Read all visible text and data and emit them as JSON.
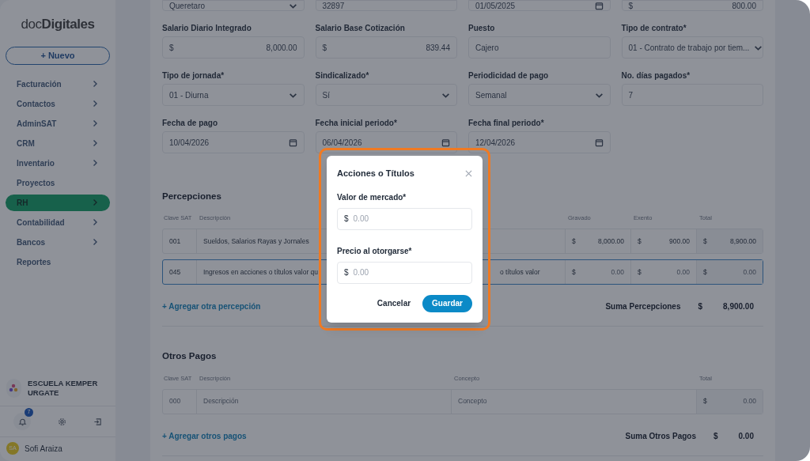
{
  "sidebar": {
    "logo": "doc**Digitales**",
    "new_button": "+ Nuevo",
    "items": [
      {
        "label": "Facturación",
        "has_submenu": true,
        "selected": false
      },
      {
        "label": "Contactos",
        "has_submenu": true,
        "selected": false
      },
      {
        "label": "AdminSAT",
        "has_submenu": true,
        "selected": false
      },
      {
        "label": "CRM",
        "has_submenu": true,
        "selected": false
      },
      {
        "label": "Inventario",
        "has_submenu": true,
        "selected": false
      },
      {
        "label": "Proyectos",
        "has_submenu": false,
        "selected": false
      },
      {
        "label": "RH",
        "has_submenu": true,
        "selected": true
      },
      {
        "label": "Contabilidad",
        "has_submenu": true,
        "selected": false
      },
      {
        "label": "Bancos",
        "has_submenu": true,
        "selected": false
      },
      {
        "label": "Reportes",
        "has_submenu": false,
        "selected": false
      }
    ],
    "company": "ESCUELA KEMPER URGATE",
    "notifications": "7",
    "user_initials": "SA",
    "user_name": "Sofi Araiza"
  },
  "form_rows": [
    [
      {
        "kind": "select",
        "value": "Queretaro"
      },
      {
        "kind": "text",
        "value": "32897"
      },
      {
        "kind": "date",
        "value": "01/05/2025"
      },
      {
        "kind": "money",
        "value": "800.00"
      }
    ],
    [
      {
        "kind": "money",
        "label": "Salario Diario Integrado",
        "value": "8,000.00"
      },
      {
        "kind": "money",
        "label": "Salario Base Cotización",
        "value": "839.44"
      },
      {
        "kind": "text",
        "label": "Puesto",
        "value": "Cajero"
      },
      {
        "kind": "select",
        "label": "Tipo de contrato*",
        "value": "01 - Contrato de trabajo por tiem..."
      }
    ],
    [
      {
        "kind": "select",
        "label": "Tipo de jornada*",
        "value": "01 - Diurna"
      },
      {
        "kind": "select",
        "label": "Sindicalizado*",
        "value": "Sí"
      },
      {
        "kind": "select",
        "label": "Periodicidad de pago",
        "value": "Semanal"
      },
      {
        "kind": "text",
        "label": "No. días pagados*",
        "value": "7"
      }
    ],
    [
      {
        "kind": "date",
        "label": "Fecha de pago",
        "value": "10/04/2026"
      },
      {
        "kind": "date",
        "label": "Fecha inicial periodo*",
        "value": "06/04/2026"
      },
      {
        "kind": "date",
        "label": "Fecha final periodo*",
        "value": "12/04/2026"
      }
    ]
  ],
  "percepciones": {
    "title": "Percepciones",
    "columns": [
      "Clave SAT",
      "Descripción",
      "Gravado",
      "Exento",
      "Total"
    ],
    "rows": [
      {
        "clave": "001",
        "descripcion": "Sueldos, Salarios Rayas y Jornales",
        "gravado": "8,000.00",
        "exento": "900.00",
        "total": "8,900.00",
        "focused": false,
        "filled": true
      },
      {
        "clave": "045",
        "descripcion": "Ingresos en acciones o títulos valor qu",
        "concepto": "o títulos valor",
        "gravado": "0.00",
        "exento": "0.00",
        "total": "0.00",
        "focused": true,
        "filled": false
      }
    ],
    "add_link": "+ Agregar otra percepción",
    "sum_label": "Suma Percepciones",
    "sum_value": "8,900.00"
  },
  "otros_pagos": {
    "title": "Otros Pagos",
    "columns": [
      "Clave SAT",
      "Descripción",
      "Concepto",
      "Total"
    ],
    "rows": [
      {
        "clave": "000",
        "descripcion": "Descripción",
        "concepto": "Concepto",
        "total": "0.00"
      }
    ],
    "add_link": "+ Agregar otros pagos",
    "sum_label": "Suma Otros Pagos",
    "sum_value": "0.00"
  },
  "currency": "$",
  "modal": {
    "title": "Acciones o Títulos",
    "fields": [
      {
        "label": "Valor de mercado*",
        "placeholder": "0.00"
      },
      {
        "label": "Precio al otorgarse*",
        "placeholder": "0.00"
      }
    ],
    "cancel": "Cancelar",
    "save": "Guardar"
  }
}
